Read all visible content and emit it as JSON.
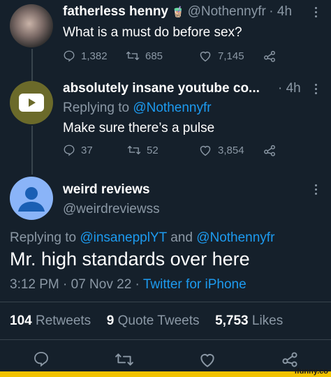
{
  "tweet1": {
    "name": "fatherless henny",
    "emoji": "🧋",
    "handle": "@Nothennyfr",
    "time": "· 4h",
    "text": "What is a must do before sex?",
    "replies": "1,382",
    "retweets": "685",
    "likes": "7,145"
  },
  "tweet2": {
    "name": "absolutely insane youtube co...",
    "time": "· 4h",
    "replying_prefix": "Replying to ",
    "replying_handle": "@Nothennyfr",
    "text": "Make sure there’s a pulse",
    "replies": "37",
    "retweets": "52",
    "likes": "3,854"
  },
  "main": {
    "name": "weird reviews",
    "handle": "@weirdreviewss",
    "replying_prefix": "Replying to ",
    "replying_handle1": "@insanepplYT",
    "replying_and": " and ",
    "replying_handle2": "@Nothennyfr",
    "text": "Mr. high standards over here",
    "datetime": "3:12 PM · 07 Nov 22 · ",
    "source": "Twitter for iPhone",
    "retweets_count": "104",
    "retweets_label": " Retweets",
    "quotes_count": "9",
    "quotes_label": " Quote Tweets",
    "likes_count": "5,753",
    "likes_label": " Likes"
  },
  "watermark": "ifunny.co",
  "colors": {
    "background": "#15202b",
    "link": "#1d9bf0",
    "muted": "#8b98a5",
    "youtube_avatar": "#6b6a2a",
    "default_avatar": "#8ab4f8",
    "watermark_bar": "#f2c200"
  }
}
